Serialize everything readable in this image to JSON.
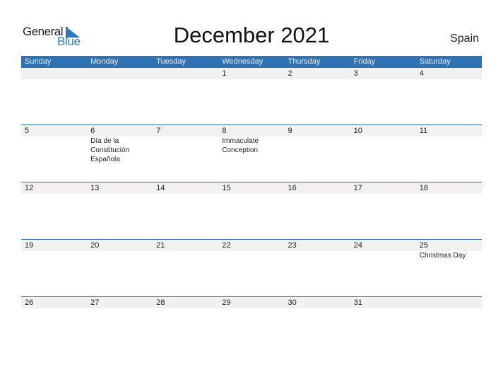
{
  "logo": {
    "general": "General",
    "blue": "Blue"
  },
  "title": "December 2021",
  "country": "Spain",
  "weekdays": [
    "Sunday",
    "Monday",
    "Tuesday",
    "Wednesday",
    "Thursday",
    "Friday",
    "Saturday"
  ],
  "weeks": [
    {
      "days": [
        "",
        "",
        "",
        "1",
        "2",
        "3",
        "4"
      ],
      "holidays": [
        "",
        "",
        "",
        "",
        "",
        "",
        ""
      ]
    },
    {
      "days": [
        "5",
        "6",
        "7",
        "8",
        "9",
        "10",
        "11"
      ],
      "holidays": [
        "",
        "Día de la\nConstitución\nEspañola",
        "",
        "Immaculate\nConception",
        "",
        "",
        ""
      ]
    },
    {
      "days": [
        "12",
        "13",
        "14",
        "15",
        "16",
        "17",
        "18"
      ],
      "holidays": [
        "",
        "",
        "",
        "",
        "",
        "",
        ""
      ]
    },
    {
      "days": [
        "19",
        "20",
        "21",
        "22",
        "23",
        "24",
        "25"
      ],
      "holidays": [
        "",
        "",
        "",
        "",
        "",
        "",
        "Christmas Day"
      ]
    },
    {
      "days": [
        "26",
        "27",
        "28",
        "29",
        "30",
        "31",
        ""
      ],
      "holidays": [
        "",
        "",
        "",
        "",
        "",
        "",
        ""
      ]
    }
  ],
  "colors": {
    "header": "#2f72b4",
    "brand_blue": "#2a78c4",
    "band": "#f1f1f1"
  }
}
